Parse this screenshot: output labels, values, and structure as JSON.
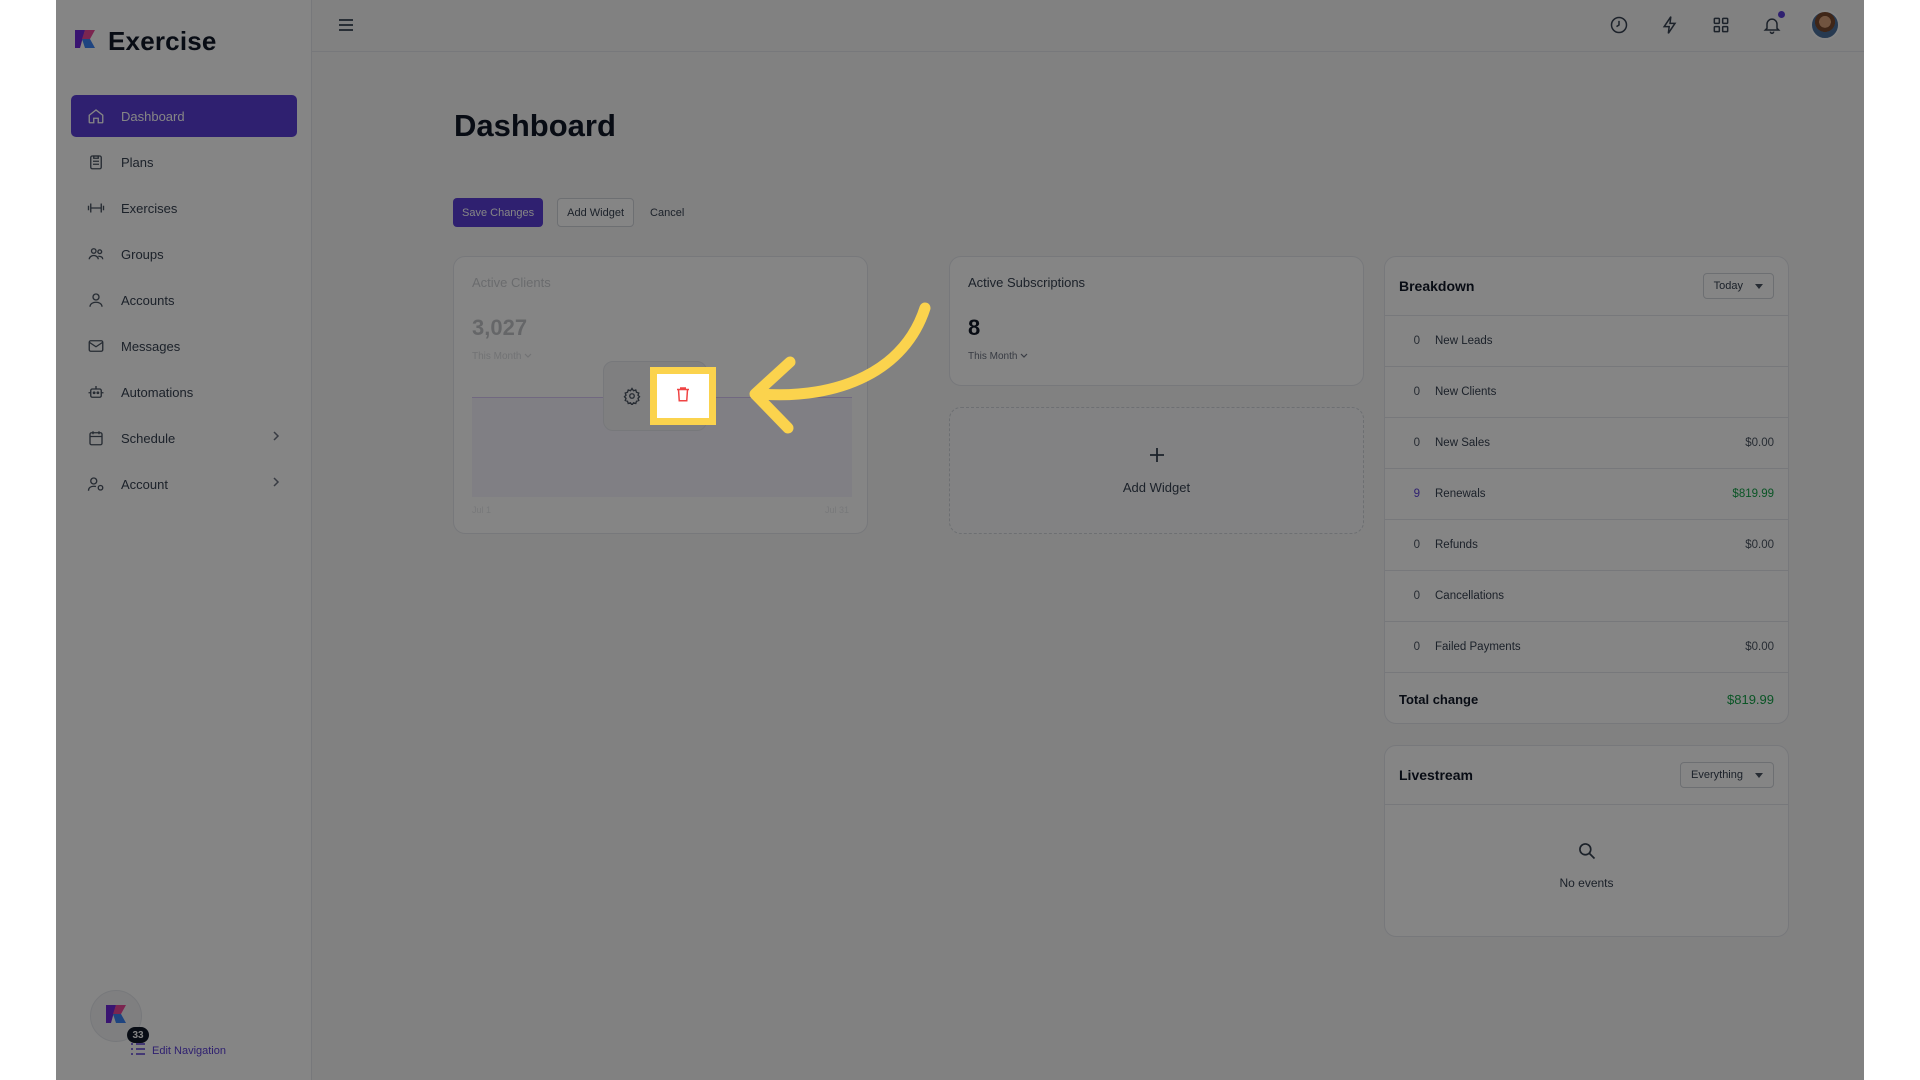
{
  "brand": {
    "name": "Exercise"
  },
  "sidebar": {
    "items": [
      {
        "label": "Dashboard",
        "icon": "home-icon",
        "active": true
      },
      {
        "label": "Plans",
        "icon": "clipboard-icon"
      },
      {
        "label": "Exercises",
        "icon": "dumbbell-icon"
      },
      {
        "label": "Groups",
        "icon": "users-icon"
      },
      {
        "label": "Accounts",
        "icon": "user-icon"
      },
      {
        "label": "Messages",
        "icon": "mail-icon"
      },
      {
        "label": "Automations",
        "icon": "robot-icon"
      },
      {
        "label": "Schedule",
        "icon": "calendar-icon",
        "has_submenu": true
      },
      {
        "label": "Account",
        "icon": "user-settings-icon",
        "has_submenu": true
      }
    ],
    "footer": {
      "badge_count": "33",
      "edit_label": "Edit Navigation"
    }
  },
  "page": {
    "title": "Dashboard"
  },
  "actions": {
    "save": "Save Changes",
    "add_widget": "Add Widget",
    "cancel": "Cancel"
  },
  "widgets": {
    "active_clients": {
      "label": "Active Clients",
      "value": "3,027",
      "period": "This Month",
      "x_start": "Jul 1",
      "x_end": "Jul 31"
    },
    "active_subscriptions": {
      "label": "Active Subscriptions",
      "value": "8",
      "period": "This Month"
    },
    "add_widget": {
      "label": "Add Widget"
    }
  },
  "breakdown": {
    "title": "Breakdown",
    "filter": "Today",
    "rows": [
      {
        "count": "0",
        "label": "New Leads",
        "amount": ""
      },
      {
        "count": "0",
        "label": "New Clients",
        "amount": ""
      },
      {
        "count": "0",
        "label": "New Sales",
        "amount": "$0.00"
      },
      {
        "count": "9",
        "label": "Renewals",
        "amount": "$819.99"
      },
      {
        "count": "0",
        "label": "Refunds",
        "amount": "$0.00"
      },
      {
        "count": "0",
        "label": "Cancellations",
        "amount": ""
      },
      {
        "count": "0",
        "label": "Failed Payments",
        "amount": "$0.00"
      }
    ],
    "total_label": "Total change",
    "total_value": "$819.99"
  },
  "livestream": {
    "title": "Livestream",
    "filter": "Everything",
    "empty": "No events"
  },
  "colors": {
    "accent": "#5b3fd6",
    "positive": "#16a34a",
    "danger": "#ef4444",
    "highlight": "#fbd34d"
  }
}
